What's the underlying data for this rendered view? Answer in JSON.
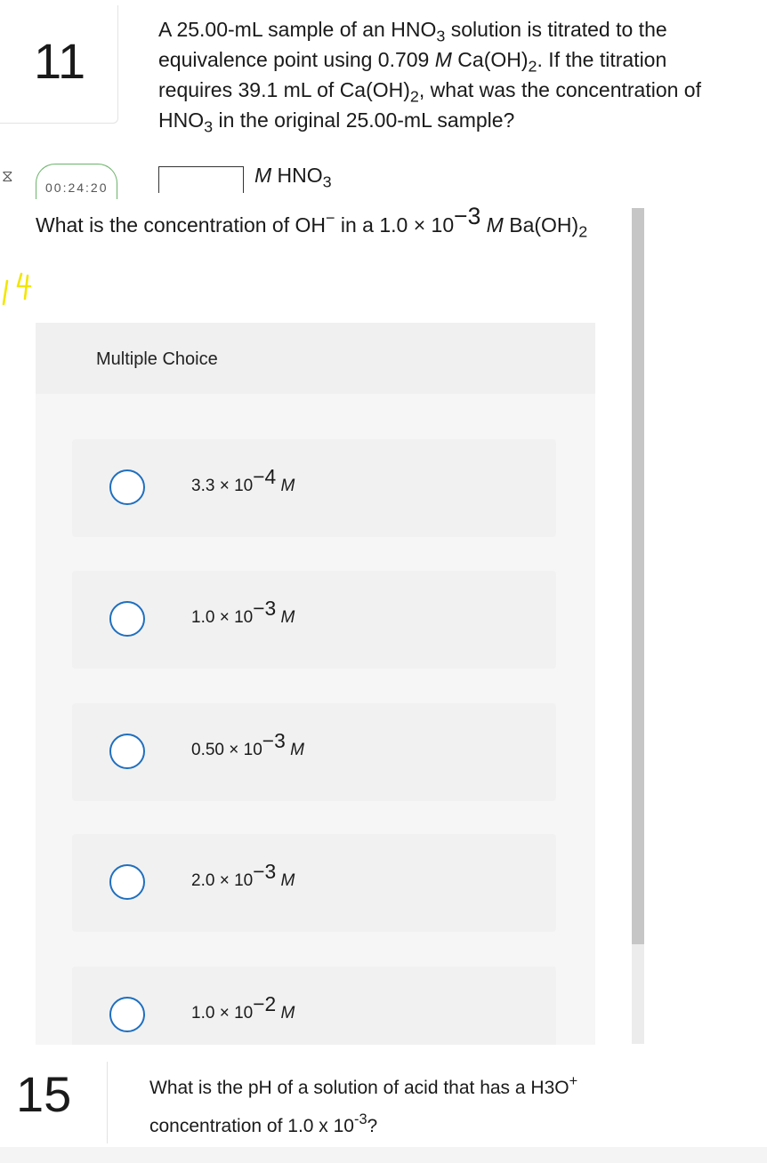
{
  "q11": {
    "number": "11",
    "line1_a": "A 25.00-mL sample of an HNO",
    "line1_sub": "3",
    "line1_b": " solution is titrated to the",
    "line2_a": "equivalence point using 0.709 ",
    "line2_m": "M",
    "line2_b": " Ca(OH)",
    "line2_sub": "2",
    "line2_c": ".  If the titration",
    "line3_a": "requires 39.1 mL of Ca(OH)",
    "line3_sub": "2",
    "line3_b": ", what was the concentration of",
    "line4_a": "HNO",
    "line4_sub": "3",
    "line4_b": " in the original 25.00-mL sample?",
    "answer_value": "",
    "answer_unit_m": "M",
    "answer_unit_a": " HNO",
    "answer_unit_sub": "3",
    "timer": "00:24:20",
    "timer_icon": "hourglass-icon"
  },
  "q14": {
    "question_a": "What is the concentration of OH",
    "question_sup": "−",
    "question_b": " in a 1.0 × 10",
    "question_exp": "−3",
    "question_m": " M",
    "question_c": " Ba(OH)",
    "question_sub": "2",
    "handwritten_label": "14",
    "mc_title": "Multiple Choice",
    "options": [
      {
        "base": "3.3 × 10",
        "exp": "−4",
        "unit": "M",
        "selected": false
      },
      {
        "base": "1.0 × 10",
        "exp": "−3",
        "unit": "M",
        "selected": false
      },
      {
        "base": "0.50 × 10",
        "exp": "−3",
        "unit": "M",
        "selected": false
      },
      {
        "base": "2.0 × 10",
        "exp": "−3",
        "unit": "M",
        "selected": false
      },
      {
        "base": "1.0 × 10",
        "exp": "−2",
        "unit": "M",
        "selected": false
      }
    ]
  },
  "q15": {
    "number": "15",
    "line1_a": "What is the pH of a solution of acid that has a H3O",
    "line1_sup": "+",
    "line2_a": "concentration of 1.0 x 10",
    "line2_sup": "-3",
    "line2_b": "?"
  },
  "colors": {
    "radio_border": "#1f6fbf",
    "handwriting": "#f2e600",
    "timer_border": "#6bb36b"
  }
}
